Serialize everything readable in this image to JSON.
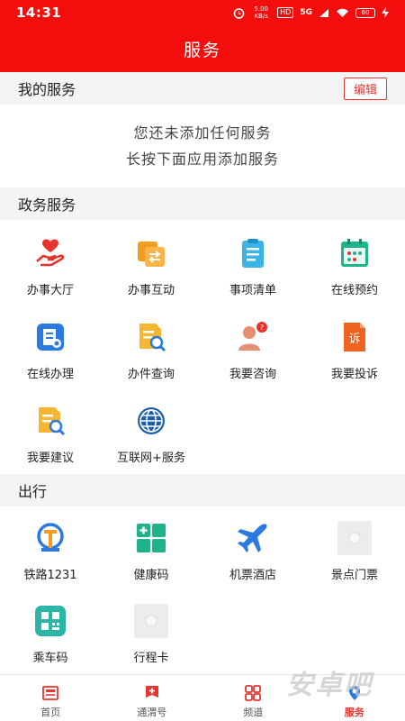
{
  "status": {
    "time": "14:31",
    "speed": "5.00 KB/s",
    "hd": "HD",
    "net": "5G",
    "battery": "60"
  },
  "app": {
    "title": "服务"
  },
  "my_services": {
    "title": "我的服务",
    "edit_label": "编辑",
    "empty_line1": "您还未添加任何服务",
    "empty_line2": "长按下面应用添加服务"
  },
  "gov": {
    "title": "政务服务",
    "items": [
      {
        "label": "办事大厅",
        "icon": "heart-hand-icon"
      },
      {
        "label": "办事互动",
        "icon": "interaction-icon"
      },
      {
        "label": "事项清单",
        "icon": "checklist-icon"
      },
      {
        "label": "在线预约",
        "icon": "calendar-icon"
      },
      {
        "label": "在线办理",
        "icon": "online-process-icon"
      },
      {
        "label": "办件查询",
        "icon": "document-search-icon"
      },
      {
        "label": "我要咨询",
        "icon": "consult-icon"
      },
      {
        "label": "我要投诉",
        "icon": "complaint-icon"
      },
      {
        "label": "我要建议",
        "icon": "suggestion-icon"
      },
      {
        "label": "互联网+服务",
        "icon": "globe-icon"
      }
    ]
  },
  "travel": {
    "title": "出行",
    "items": [
      {
        "label": "铁路1231",
        "icon": "railway-icon"
      },
      {
        "label": "健康码",
        "icon": "health-code-icon"
      },
      {
        "label": "机票酒店",
        "icon": "airplane-icon"
      },
      {
        "label": "景点门票",
        "icon": "image-placeholder-icon"
      },
      {
        "label": "乘车码",
        "icon": "ride-qr-icon"
      },
      {
        "label": "行程卡",
        "icon": "image-placeholder-icon"
      }
    ]
  },
  "nav": [
    {
      "label": "首页",
      "icon": "home-news-icon"
    },
    {
      "label": "通渭号",
      "icon": "flag-plus-icon"
    },
    {
      "label": "频道",
      "icon": "grid-icon"
    },
    {
      "label": "服务",
      "icon": "service-icon"
    }
  ],
  "colors": {
    "brand_red": "#f40d0d",
    "accent_red": "#e5362f",
    "orange": "#f39c1f",
    "blue": "#2a7ae2",
    "green": "#1fb38a"
  },
  "watermark": "安卓吧"
}
